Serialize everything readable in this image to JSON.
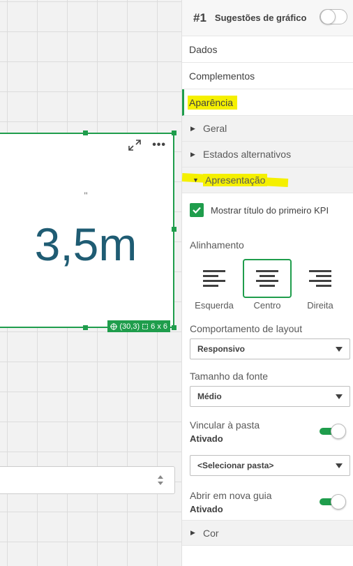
{
  "kpi": {
    "title": "''",
    "value": "3,5m",
    "position_badge": "(30,3)",
    "size_badge": "6 x 6"
  },
  "panel": {
    "header": {
      "number": "#1",
      "title": "Sugestões de gráfico"
    },
    "sections": {
      "dados": "Dados",
      "complementos": "Complementos",
      "aparencia": "Aparência"
    },
    "subsections": {
      "geral": "Geral",
      "estados": "Estados alternativos",
      "apresentacao": "Apresentação",
      "cor": "Cor"
    },
    "checkbox_label": "Mostrar título do primeiro KPI",
    "alignment": {
      "label": "Alinhamento",
      "options": [
        "Esquerda",
        "Centro",
        "Direita"
      ],
      "selected": "Centro"
    },
    "layout": {
      "label": "Comportamento de layout",
      "value": "Responsivo"
    },
    "font_size": {
      "label": "Tamanho da fonte",
      "value": "Médio"
    },
    "link_sheet": {
      "label": "Vincular à pasta",
      "state": "Ativado",
      "select_value": "<Selecionar pasta>"
    },
    "new_tab": {
      "label": "Abrir em nova guia",
      "state": "Ativado"
    }
  },
  "colors": {
    "accent": "#1f9d4c",
    "kpi_value": "#1f5c73",
    "highlight": "#f5f000"
  }
}
